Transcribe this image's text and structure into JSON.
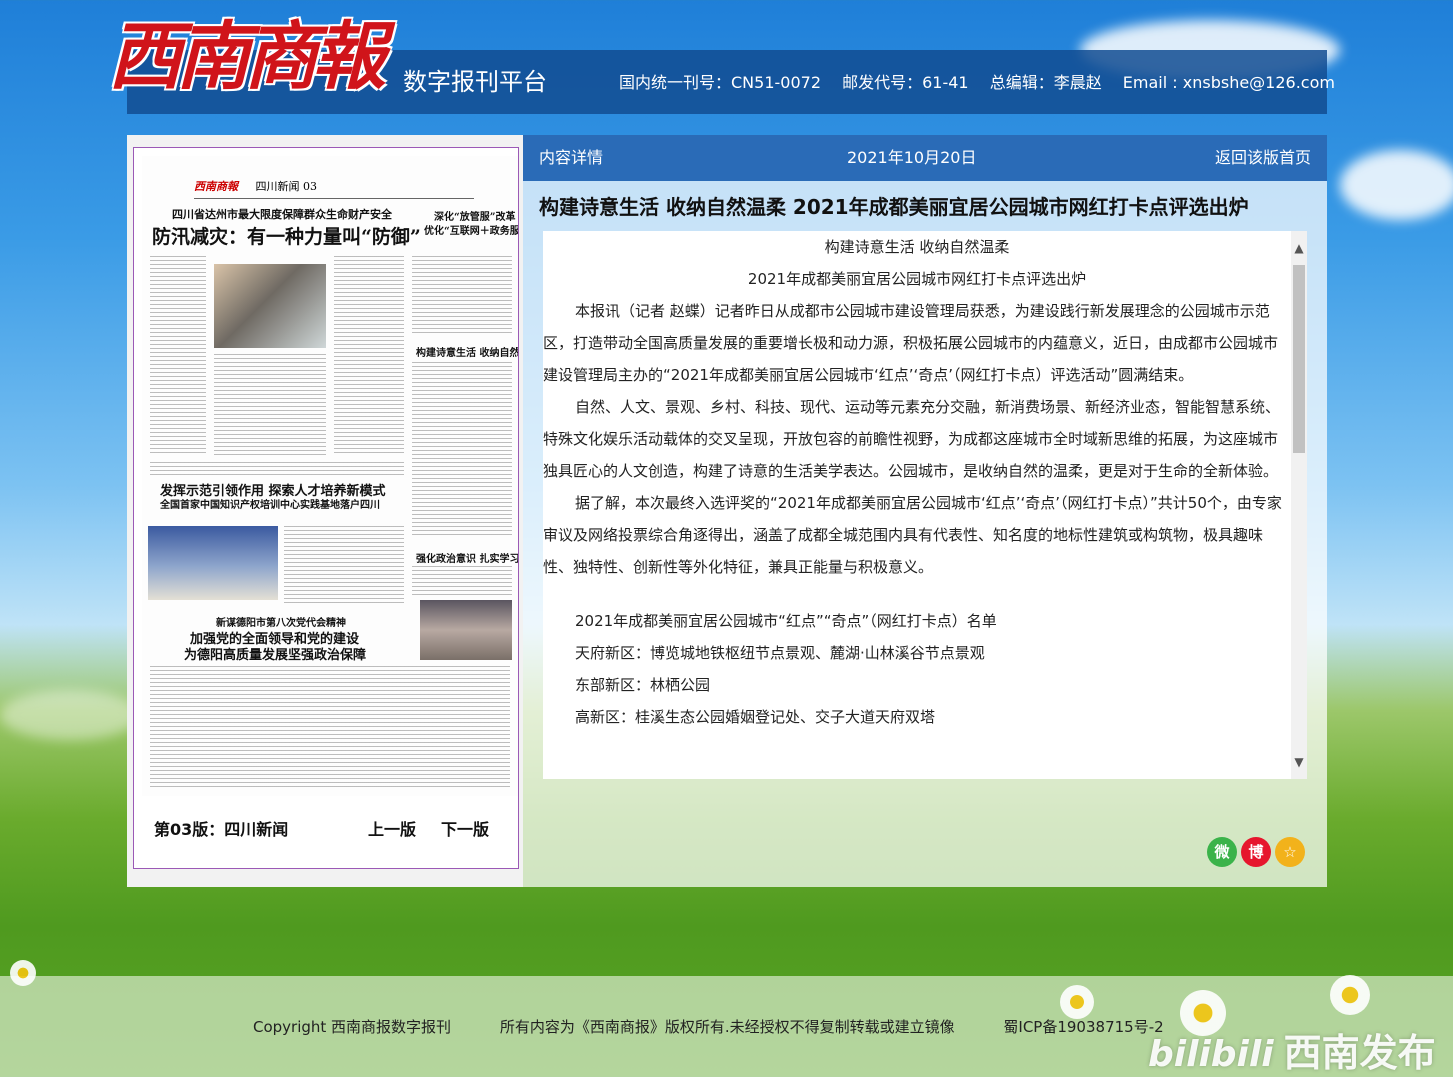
{
  "header": {
    "logo_text": "西南商報",
    "platform": "数字报刊平台",
    "issn": "国内统一刊号：CN51-0072",
    "postal": "邮发代号：61-41",
    "editor": "总编辑：李晨赵",
    "email": "Email : xnsbshe@126.com"
  },
  "left": {
    "paper": {
      "masthead_logo": "西南商報",
      "masthead_section": "四川新闻 03",
      "headline1_kicker": "四川省达州市最大限度保障群众生命财产安全",
      "headline1": "防汛减灾：有一种力量叫“防御”",
      "headline2": "发挥示范引领作用 探索人才培养新模式",
      "headline2_sub": "全国首家中国知识产权培训中心实践基地落户四川",
      "headline3_kicker": "新谋德阳市第八次党代会精神",
      "headline3a": "加强党的全面领导和党的建设",
      "headline3b": "为德阳高质量发展坚强政治保障",
      "side1": "深化“放管服”改革",
      "side1b": "优化“互联网＋政务服务”",
      "side2": "构建诗意生活 收纳自然温柔",
      "side3": "强化政治意识 扎实学习路径"
    },
    "page_label": "第03版：四川新闻",
    "prev": "上一版",
    "next": "下一版"
  },
  "right": {
    "bar_left": "内容详情",
    "bar_date": "2021年10月20日",
    "bar_right": "返回该版首页",
    "title": "构建诗意生活 收纳自然温柔 2021年成都美丽宜居公园城市网红打卡点评选出炉",
    "article": {
      "sub1": "构建诗意生活 收纳自然温柔",
      "sub2": "2021年成都美丽宜居公园城市网红打卡点评选出炉",
      "p1": "本报讯（记者 赵蝶）记者昨日从成都市公园城市建设管理局获悉，为建设践行新发展理念的公园城市示范区，打造带动全国高质量发展的重要增长极和动力源，积极拓展公园城市的内蕴意义，近日，由成都市公园城市建设管理局主办的“2021年成都美丽宜居公园城市‘红点’‘奇点’（网红打卡点）评选活动”圆满结束。",
      "p2": "自然、人文、景观、乡村、科技、现代、运动等元素充分交融，新消费场景、新经济业态，智能智慧系统、特殊文化娱乐活动载体的交叉呈现，开放包容的前瞻性视野，为成都这座城市全时域新思维的拓展，为这座城市独具匠心的人文创造，构建了诗意的生活美学表达。公园城市，是收纳自然的温柔，更是对于生命的全新体验。",
      "p3": "据了解，本次最终入选评奖的“2021年成都美丽宜居公园城市‘红点’‘奇点’（网红打卡点）”共计50个，由专家审议及网络投票综合角逐得出，涵盖了成都全城范围内具有代表性、知名度的地标性建筑或构筑物，极具趣味性、独特性、创新性等外化特征，兼具正能量与积极意义。",
      "list_title": "2021年成都美丽宜居公园城市“红点”“奇点”（网红打卡点）名单",
      "item1": "天府新区：博览城地铁枢纽节点景观、麓湖·山林溪谷节点景观",
      "item2": "东部新区：林栖公园",
      "item3": "高新区：桂溪生态公园婚姻登记处、交子大道天府双塔"
    }
  },
  "share": {
    "wechat": "微",
    "weibo": "博",
    "fav": "☆"
  },
  "footer": {
    "copyright": "Copyright 西南商报数字报刊",
    "rights": "所有内容为《西南商报》版权所有.未经授权不得复制转载或建立镜像",
    "icp": "蜀ICP备19038715号-2"
  },
  "watermark": {
    "brand": "bilibili",
    "text": "西南发布"
  },
  "colors": {
    "header_bar": "#124c92",
    "content_bar": "#2a6bb7",
    "logo_red": "#d0141a",
    "wechat": "#3bb34a",
    "weibo": "#e6162d",
    "fav": "#f2b21b"
  }
}
